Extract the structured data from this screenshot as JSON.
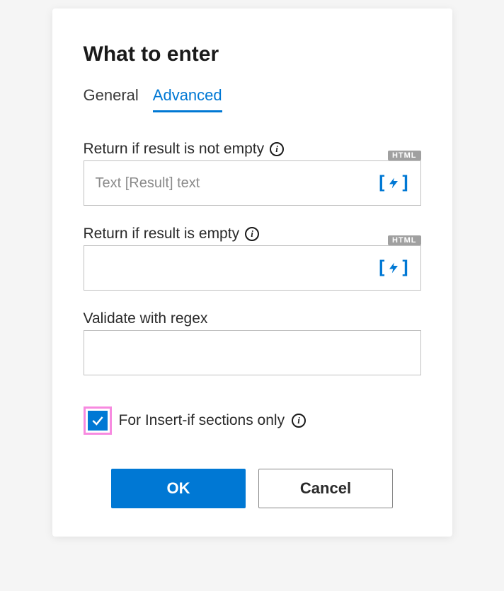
{
  "dialog": {
    "title": "What to enter"
  },
  "tabs": {
    "general": "General",
    "advanced": "Advanced",
    "active": "advanced"
  },
  "fields": {
    "notEmpty": {
      "label": "Return if result is not empty",
      "placeholder": "Text [Result] text",
      "badge": "HTML",
      "value": ""
    },
    "empty": {
      "label": "Return if result is empty",
      "placeholder": "",
      "badge": "HTML",
      "value": ""
    },
    "regex": {
      "label": "Validate with regex",
      "value": ""
    }
  },
  "checkbox": {
    "label": "For Insert-if sections only",
    "checked": true
  },
  "buttons": {
    "ok": "OK",
    "cancel": "Cancel"
  }
}
